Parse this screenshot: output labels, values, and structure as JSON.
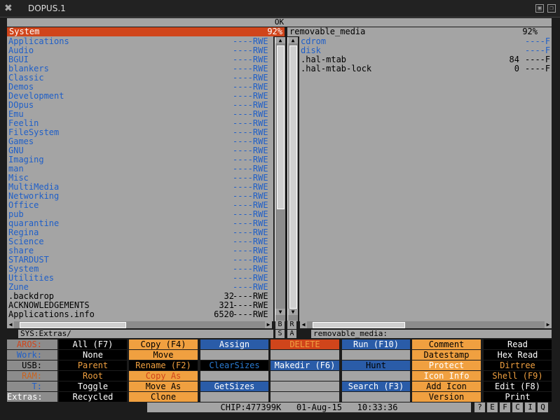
{
  "window": {
    "title": "DOPUS.1",
    "ok_label": "OK"
  },
  "colors": {
    "panel": "#a4a4a4",
    "active_header": "#d0451b",
    "dir_text": "#1f5fc8"
  },
  "left": {
    "header": "System",
    "percent": "92%",
    "path": "SYS:Extras/",
    "rows": [
      {
        "name": "Applications",
        "size": "",
        "prot": "----RWE",
        "type": "dir"
      },
      {
        "name": "Audio",
        "size": "",
        "prot": "----RWE",
        "type": "dir"
      },
      {
        "name": "BGUI",
        "size": "",
        "prot": "----RWE",
        "type": "dir"
      },
      {
        "name": "blankers",
        "size": "",
        "prot": "----RWE",
        "type": "dir"
      },
      {
        "name": "Classic",
        "size": "",
        "prot": "----RWE",
        "type": "dir"
      },
      {
        "name": "Demos",
        "size": "",
        "prot": "----RWE",
        "type": "dir"
      },
      {
        "name": "Development",
        "size": "",
        "prot": "----RWE",
        "type": "dir"
      },
      {
        "name": "DOpus",
        "size": "",
        "prot": "----RWE",
        "type": "dir"
      },
      {
        "name": "Emu",
        "size": "",
        "prot": "----RWE",
        "type": "dir"
      },
      {
        "name": "Feelin",
        "size": "",
        "prot": "----RWE",
        "type": "dir"
      },
      {
        "name": "FileSystem",
        "size": "",
        "prot": "----RWE",
        "type": "dir"
      },
      {
        "name": "Games",
        "size": "",
        "prot": "----RWE",
        "type": "dir"
      },
      {
        "name": "GNU",
        "size": "",
        "prot": "----RWE",
        "type": "dir"
      },
      {
        "name": "Imaging",
        "size": "",
        "prot": "----RWE",
        "type": "dir"
      },
      {
        "name": "man",
        "size": "",
        "prot": "----RWE",
        "type": "dir"
      },
      {
        "name": "Misc",
        "size": "",
        "prot": "----RWE",
        "type": "dir"
      },
      {
        "name": "MultiMedia",
        "size": "",
        "prot": "----RWE",
        "type": "dir"
      },
      {
        "name": "Networking",
        "size": "",
        "prot": "----RWE",
        "type": "dir"
      },
      {
        "name": "Office",
        "size": "",
        "prot": "----RWE",
        "type": "dir"
      },
      {
        "name": "pub",
        "size": "",
        "prot": "----RWE",
        "type": "dir"
      },
      {
        "name": "quarantine",
        "size": "",
        "prot": "----RWE",
        "type": "dir"
      },
      {
        "name": "Regina",
        "size": "",
        "prot": "----RWE",
        "type": "dir"
      },
      {
        "name": "Science",
        "size": "",
        "prot": "----RWE",
        "type": "dir"
      },
      {
        "name": "share",
        "size": "",
        "prot": "----RWE",
        "type": "dir"
      },
      {
        "name": "STARDUST",
        "size": "",
        "prot": "----RWE",
        "type": "dir"
      },
      {
        "name": "System",
        "size": "",
        "prot": "----RWE",
        "type": "dir"
      },
      {
        "name": "Utilities",
        "size": "",
        "prot": "----RWE",
        "type": "dir"
      },
      {
        "name": "Zune",
        "size": "",
        "prot": "----RWE",
        "type": "dir"
      },
      {
        "name": ".backdrop",
        "size": "32",
        "prot": "----RWE",
        "type": "file"
      },
      {
        "name": "ACKNOWLEDGEMENTS",
        "size": "321",
        "prot": "----RWE",
        "type": "file"
      },
      {
        "name": "Applications.info",
        "size": "6520",
        "prot": "----RWE",
        "type": "file"
      }
    ]
  },
  "right": {
    "header": "removable_media",
    "percent": "92%",
    "path": "removable_media:",
    "rows": [
      {
        "name": "cdrom",
        "size": "",
        "prot": "----F",
        "type": "dir"
      },
      {
        "name": "disk",
        "size": "",
        "prot": "----F",
        "type": "dir"
      },
      {
        "name": ".hal-mtab",
        "size": "84",
        "prot": "----F",
        "type": "file"
      },
      {
        "name": ".hal-mtab-lock",
        "size": "0",
        "prot": "----F",
        "type": "file"
      }
    ]
  },
  "middle": {
    "b": "B",
    "s": "S",
    "r": "R",
    "a": "A"
  },
  "devices": [
    "AROS:",
    "Work:",
    "USB:",
    "RAM:",
    "T:",
    "Extras:"
  ],
  "buttons": [
    [
      "All (F7)",
      "Copy (F4)",
      "Assign",
      "DELETE",
      "Run (F10)",
      "Comment",
      "Read"
    ],
    [
      "None",
      "Move",
      "",
      "",
      "",
      "Datestamp",
      "Hex Read"
    ],
    [
      "Parent",
      "Rename (F2)",
      "ClearSizes",
      "Makedir (F6)",
      "Hunt",
      "Protect",
      "Dirtree"
    ],
    [
      "Root",
      "Copy As",
      "",
      "",
      "",
      "Icon Info",
      "Shell (F9)"
    ],
    [
      "Toggle",
      "Move As",
      "GetSizes",
      "",
      "Search (F3)",
      "Add Icon",
      "Edit (F8)"
    ],
    [
      "Recycled",
      "Clone",
      "",
      "",
      "",
      "Version",
      "Print"
    ]
  ],
  "status": {
    "chip": "CHIP:477399K",
    "date": "01-Aug-15",
    "time": "10:33:36"
  },
  "small_buttons": [
    "?",
    "E",
    "F",
    "C",
    "I",
    "Q"
  ]
}
